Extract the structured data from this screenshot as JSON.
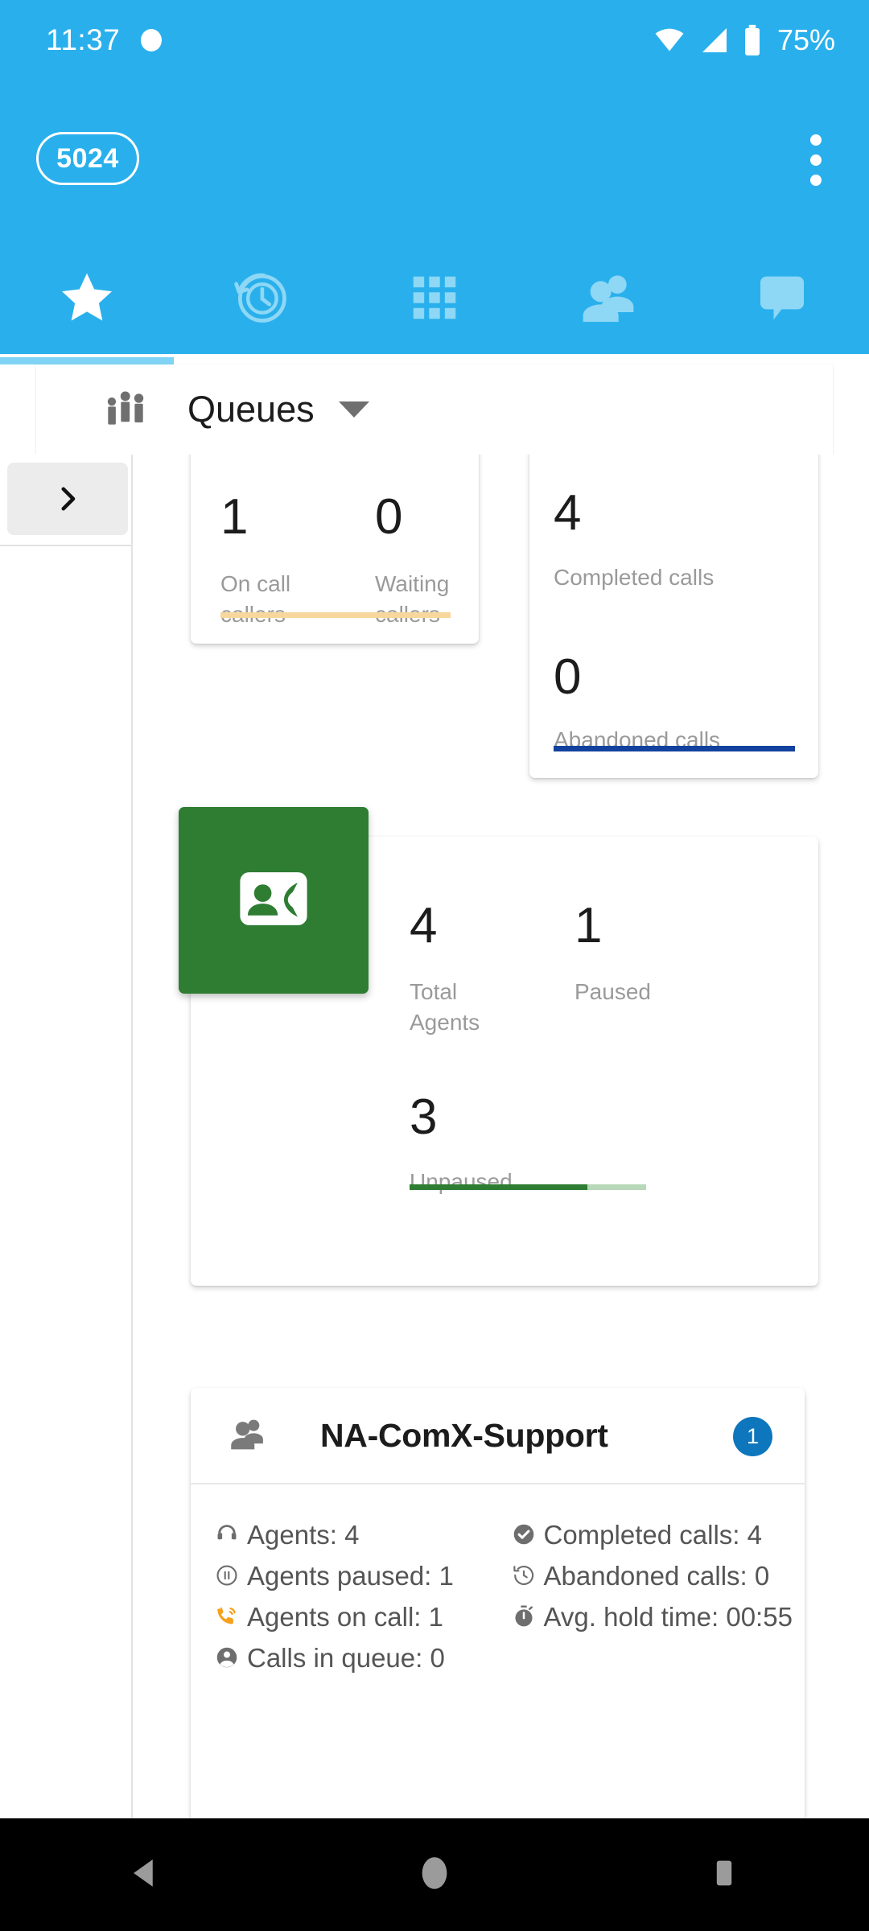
{
  "status_bar": {
    "time": "11:37",
    "battery_percent": "75%",
    "icons": [
      "notification-dot-icon",
      "wifi-icon",
      "cellular-signal-icon",
      "battery-icon"
    ]
  },
  "app_bar": {
    "extension_chip": "5024",
    "overflow_menu": "more-options",
    "background_color": "#29b0ec",
    "tabs": [
      {
        "name": "favorites",
        "icon": "star-icon",
        "active": true
      },
      {
        "name": "history",
        "icon": "history-clock-icon",
        "active": false
      },
      {
        "name": "keypad",
        "icon": "dialpad-grid-icon",
        "active": false
      },
      {
        "name": "contacts",
        "icon": "people-icon",
        "active": false
      },
      {
        "name": "messages",
        "icon": "chat-bubble-icon",
        "active": false
      }
    ]
  },
  "section_header": {
    "icon": "group-people-icon",
    "title": "Queues",
    "caret": "chevron-down-icon"
  },
  "left_rail": {
    "expand_button_icon": "chevron-right-icon"
  },
  "cards": {
    "callers": {
      "metrics": [
        {
          "value": "1",
          "label": "On call callers"
        },
        {
          "value": "0",
          "label": "Waiting callers"
        }
      ],
      "bar_color": "#f7d79b"
    },
    "calls": {
      "metrics": [
        {
          "value": "4",
          "label": "Completed calls"
        },
        {
          "value": "0",
          "label": "Abandoned calls"
        }
      ],
      "bar_color": "#13419e"
    },
    "agents": {
      "tile_icon": "contact-phone-icon",
      "tile_color": "#2e7d32",
      "metrics": [
        {
          "value": "4",
          "label": "Total Agents"
        },
        {
          "value": "1",
          "label": "Paused"
        }
      ],
      "bottom_metric": {
        "value": "3",
        "label": "Unpaused"
      },
      "bar_color": "#2e7d32",
      "bar_track_color": "#b7d8b9",
      "bar_fill_percent": "75%"
    }
  },
  "queue_card": {
    "icon": "people-icon",
    "title": "NA-ComX-Support",
    "badge": "1",
    "badge_color": "#0e76bc",
    "left_stats": [
      {
        "icon": "headset-icon",
        "text": "Agents: 4",
        "color": "#6e6e6e"
      },
      {
        "icon": "pause-circle-icon",
        "text": "Agents paused: 1",
        "color": "#6e6e6e"
      },
      {
        "icon": "phone-in-talk-icon",
        "text": "Agents on call: 1",
        "color": "#f5a11d"
      },
      {
        "icon": "account-circle-icon",
        "text": "Calls in queue: 0",
        "color": "#6e6e6e"
      }
    ],
    "right_stats": [
      {
        "icon": "check-circle-icon",
        "text": "Completed calls: 4",
        "color": "#6e6e6e"
      },
      {
        "icon": "history-restore-icon",
        "text": "Abandoned calls: 0",
        "color": "#6e6e6e"
      },
      {
        "icon": "timer-icon",
        "text": "Avg. hold time: 00:55",
        "color": "#6e6e6e"
      }
    ]
  },
  "nav_bar": {
    "buttons": [
      {
        "name": "back",
        "icon": "triangle-back-icon"
      },
      {
        "name": "home",
        "icon": "circle-home-icon"
      },
      {
        "name": "recents",
        "icon": "square-recents-icon"
      }
    ]
  }
}
